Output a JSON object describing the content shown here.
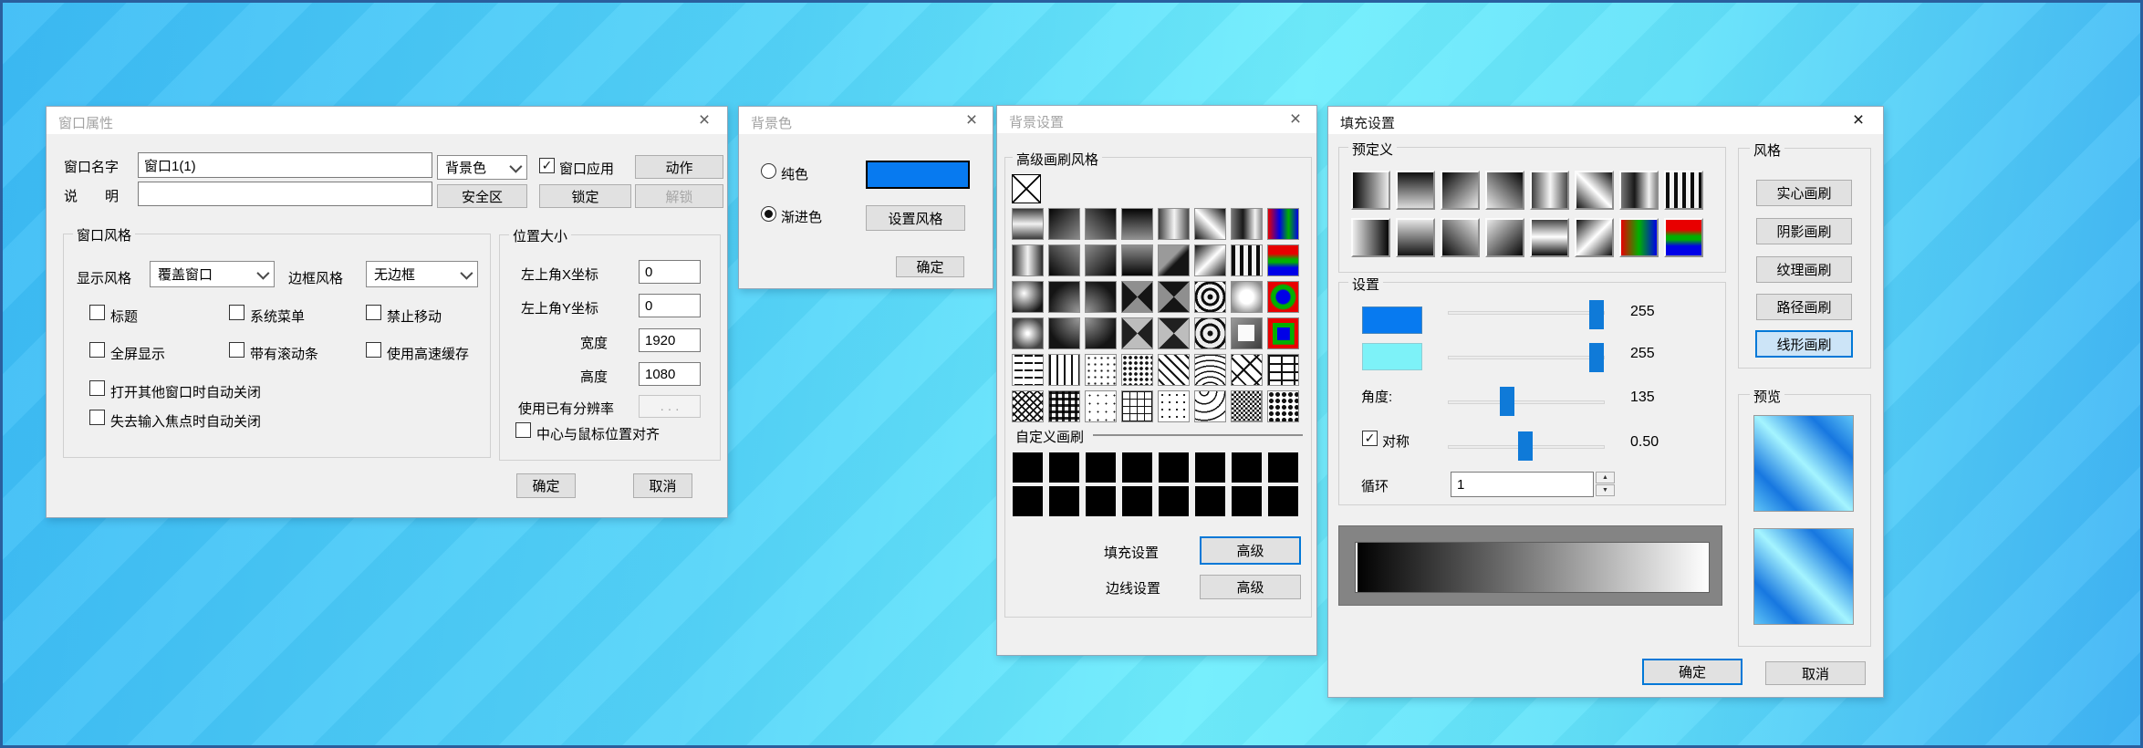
{
  "window_properties": {
    "title": "窗口属性",
    "close_glyph": "×",
    "name_label": "窗口名字",
    "name_value": "窗口1(1)",
    "desc_label": "说　　明",
    "desc_value": "",
    "bg_color_combo": "背景色",
    "window_apply_label": "窗口应用",
    "check_glyph": "✓",
    "action_button": "动作",
    "safe_area_button": "安全区",
    "lock_button": "锁定",
    "unlock_button": "解锁",
    "style_group": {
      "title": "窗口风格",
      "display_label": "显示风格",
      "display_value": "覆盖窗口",
      "border_label": "边框风格",
      "border_value": "无边框",
      "checkboxes": [
        {
          "label": "标题",
          "checked": false
        },
        {
          "label": "系统菜单",
          "checked": false
        },
        {
          "label": "禁止移动",
          "checked": false
        },
        {
          "label": "全屏显示",
          "checked": false
        },
        {
          "label": "带有滚动条",
          "checked": false
        },
        {
          "label": "使用高速缓存",
          "checked": false
        },
        {
          "label": "打开其他窗口时自动关闭",
          "checked": false
        },
        {
          "label": "失去输入焦点时自动关闭",
          "checked": false
        }
      ]
    },
    "position_group": {
      "title": "位置大小",
      "rows": [
        {
          "label": "左上角X坐标",
          "value": "0"
        },
        {
          "label": "左上角Y坐标",
          "value": "0"
        },
        {
          "label": "宽度",
          "value": "1920"
        },
        {
          "label": "高度",
          "value": "1080"
        }
      ],
      "resolution_label": "使用已有分辨率",
      "resolution_button": ". . .",
      "center_checkbox": "中心与鼠标位置对齐"
    },
    "ok_button": "确定",
    "cancel_button": "取消"
  },
  "background_color": {
    "title": "背景色",
    "close_glyph": "×",
    "solid_label": "纯色",
    "gradient_label": "渐进色",
    "swatch_color": "#077af0",
    "set_style_button": "设置风格",
    "ok_button": "确定"
  },
  "background_settings": {
    "title": "背景设置",
    "close_glyph": "×",
    "group_title": "高级画刷风格",
    "custom_title": "自定义画刷",
    "fill_label": "填充设置",
    "fill_advanced_button": "高级",
    "line_label": "边线设置",
    "line_advanced_button": "高级",
    "brush_rows": [
      [
        "band-h",
        "dark-diag-br",
        "dark-diag-bl",
        "dark-down",
        "vband-soft",
        "diag-shine-45",
        "vband-right",
        "rgb-v"
      ],
      [
        "band-v",
        "dark-diag-tr",
        "dark-diag-tl",
        "dark-up",
        "diag-split",
        "diag-shine-135",
        "stripes-v",
        "rgb-h"
      ],
      [
        "glow-center",
        "corner-br",
        "corner-bl",
        "cone-dark",
        "cone-dark2",
        "rings",
        "glow-big",
        "rgb-rings"
      ],
      [
        "star",
        "corner-tr",
        "corner-tl",
        "cone-light",
        "cone-light2",
        "squares-rings",
        "square-white",
        "rgb-squares"
      ],
      [
        "hatch-dash-h",
        "hatch-lines-v",
        "hatch-dots1",
        "hatch-dots2",
        "hatch-zigzag",
        "hatch-wave",
        "hatch-diag-brick",
        "hatch-brick"
      ],
      [
        "hatch-weave",
        "hatch-plaid",
        "hatch-divot",
        "hatch-grid-dot",
        "hatch-dots3",
        "hatch-shingle",
        "hatch-check",
        "hatch-spheres"
      ]
    ],
    "custom_rows": [
      [
        "black",
        "black",
        "black",
        "black",
        "black",
        "black",
        "black",
        "black"
      ],
      [
        "black",
        "black",
        "black",
        "black",
        "black",
        "black",
        "black",
        "black"
      ]
    ]
  },
  "fill_settings": {
    "title": "填充设置",
    "close_glyph": "×",
    "predefined_title": "预定义",
    "predefined_rows": [
      [
        "p-l2r",
        "p-t2b",
        "p-tl2br",
        "p-tr2bl",
        "vband-soft",
        "diag-shine-45",
        "vband-right",
        "stripes-v"
      ],
      [
        "p-r2l",
        "p-light-t2b",
        "p-bl2tr",
        "p-br2tl",
        "band-h-sharp",
        "diag-shine-135",
        "rgb-v3",
        "rgb-h"
      ]
    ],
    "settings_title": "设置",
    "color1": "#077af0",
    "color2": "#7df2f8",
    "slider1_value": "255",
    "slider2_value": "255",
    "angle_label": "角度:",
    "angle_value": "135",
    "symmetry_label": "对称",
    "symmetry_value": "0.50",
    "check_glyph": "✓",
    "cycle_label": "循环",
    "cycle_value": "1",
    "spin_up": "▲",
    "spin_down": "▼",
    "style_group": {
      "title": "风格",
      "buttons": [
        "实心画刷",
        "阴影画刷",
        "纹理画刷",
        "路径画刷",
        "线形画刷"
      ]
    },
    "preview_title": "预览",
    "ok_button": "确定",
    "cancel_button": "取消"
  }
}
